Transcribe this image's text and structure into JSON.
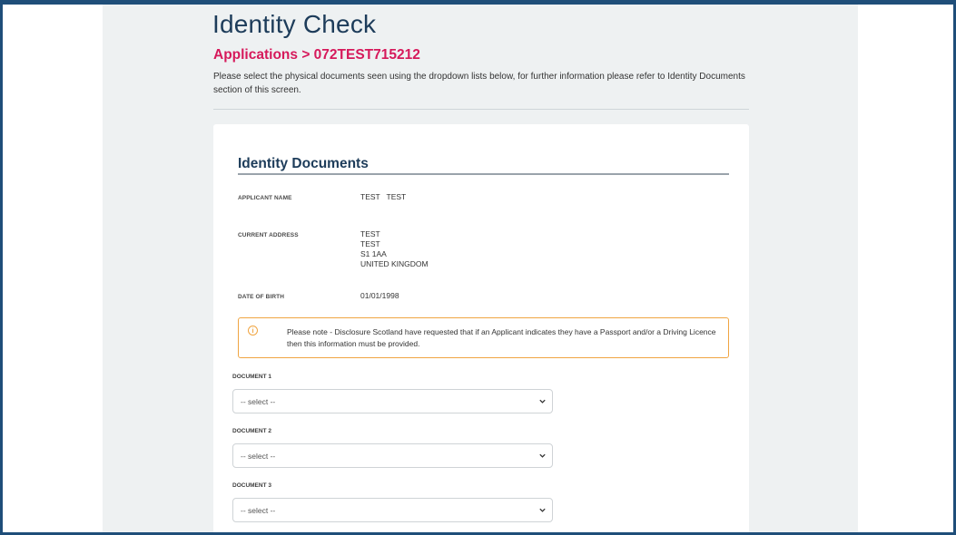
{
  "page": {
    "title": "Identity Check",
    "breadcrumb": "Applications > 072TEST715212",
    "intro": "Please select the physical documents seen using the dropdown lists below, for further information please refer to Identity Documents section of this screen."
  },
  "identity": {
    "section_title": "Identity Documents",
    "fields": [
      {
        "label": "APPLICANT NAME",
        "value": "TEST   TEST"
      },
      {
        "label": "CURRENT ADDRESS",
        "lines": [
          "TEST",
          "TEST",
          "S1 1AA",
          "UNITED KINGDOM"
        ]
      },
      {
        "label": "DATE OF BIRTH",
        "value": "01/01/1998"
      }
    ],
    "notice": {
      "icon": "info-icon",
      "text": "Please note - Disclosure Scotland have requested that if an Applicant indicates they have a Passport and/or a Driving Licence then this information must be provided."
    },
    "documents": [
      {
        "label": "DOCUMENT 1",
        "selected": "-- select --"
      },
      {
        "label": "DOCUMENT 2",
        "selected": "-- select --"
      },
      {
        "label": "DOCUMENT 3",
        "selected": "-- select --"
      }
    ]
  },
  "colors": {
    "title": "#1d3c5a",
    "breadcrumb": "#d6195b",
    "notice_border": "#f0a542",
    "frame": "#1f4e79"
  }
}
